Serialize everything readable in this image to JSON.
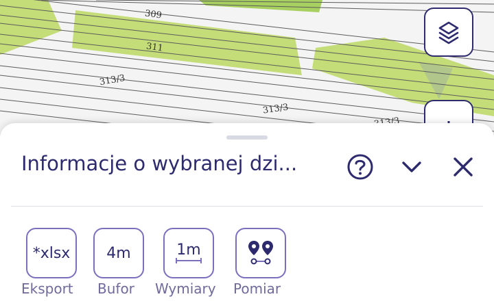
{
  "map": {
    "parcel_labels": [
      "309",
      "311",
      "313/3",
      "313/3",
      "313/3"
    ],
    "colors": {
      "parcel_fill": "#c5dd78",
      "line": "#5a5a5a"
    }
  },
  "map_controls": {
    "layers_icon": "layers-icon",
    "locate_icon": "locate-icon"
  },
  "panel": {
    "title": "Informacje o wybranej dzi...",
    "help_icon": "help-icon",
    "collapse_icon": "chevron-down-icon",
    "close_icon": "close-icon"
  },
  "tools": [
    {
      "label": "Eksport",
      "icon_text": "*xlsx"
    },
    {
      "label": "Bufor",
      "icon_text": "4m"
    },
    {
      "label": "Wymiary",
      "icon_text": "1m"
    },
    {
      "label": "Pomiar",
      "icon": "map-pins-icon"
    }
  ],
  "colors": {
    "accent": "#2d2a6e",
    "border": "#7a6fbc",
    "label": "#6f6a9a"
  }
}
